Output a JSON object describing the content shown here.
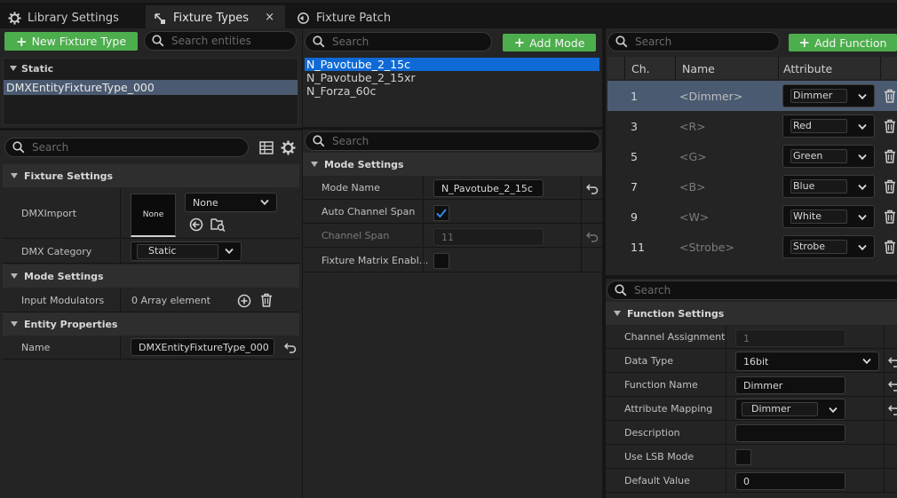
{
  "tabs": [
    {
      "label": "Library Settings",
      "icon": "gear-icon",
      "active": false
    },
    {
      "label": "Fixture Types",
      "icon": "fixture-type-icon",
      "active": true,
      "close": "×"
    },
    {
      "label": "Fixture Patch",
      "icon": "fixture-patch-icon",
      "active": false
    }
  ],
  "left": {
    "new_fixture_button": "New Fixture Type",
    "search_entities_placeholder": "Search entities",
    "group_label": "Static",
    "entities": [
      "DMXEntityFixtureType_000"
    ],
    "details_search_placeholder": "Search",
    "sections": {
      "fixture_settings": "Fixture Settings",
      "mode_settings": "Mode Settings",
      "entity_properties": "Entity Properties"
    },
    "dmx_import_label": "DMXImport",
    "dmx_import_thumb": "None",
    "dmx_import_value": "None",
    "dmx_category_label": "DMX Category",
    "dmx_category_value": "Static",
    "input_modulators_label": "Input Modulators",
    "input_modulators_value": "0 Array element",
    "name_label": "Name",
    "name_value": "DMXEntityFixtureType_000"
  },
  "middle": {
    "search_placeholder": "Search",
    "add_mode_button": "Add Mode",
    "modes": [
      "N_Pavotube_2_15c",
      "N_Pavotube_2_15xr",
      "N_Forza_60c"
    ],
    "selected_mode_index": 0,
    "details_search_placeholder": "Search",
    "mode_settings_header": "Mode Settings",
    "mode_name_label": "Mode Name",
    "mode_name_value": "N_Pavotube_2_15c",
    "auto_channel_span_label": "Auto Channel Span",
    "auto_channel_span_checked": true,
    "channel_span_label": "Channel Span",
    "channel_span_value": "11",
    "fixture_matrix_label": "Fixture Matrix Enabl...",
    "fixture_matrix_checked": false
  },
  "right": {
    "search_placeholder": "Search",
    "add_function_button": "Add Function",
    "columns": {
      "ch": "Ch.",
      "name": "Name",
      "attribute": "Attribute"
    },
    "functions": [
      {
        "ch": "1",
        "name": "<Dimmer>",
        "attribute": "Dimmer"
      },
      {
        "ch": "3",
        "name": "<R>",
        "attribute": "Red"
      },
      {
        "ch": "5",
        "name": "<G>",
        "attribute": "Green"
      },
      {
        "ch": "7",
        "name": "<B>",
        "attribute": "Blue"
      },
      {
        "ch": "9",
        "name": "<W>",
        "attribute": "White"
      },
      {
        "ch": "11",
        "name": "<Strobe>",
        "attribute": "Strobe"
      }
    ],
    "selected_function_index": 0,
    "details_search_placeholder": "Search",
    "function_settings_header": "Function Settings",
    "channel_assignment_label": "Channel Assignment",
    "channel_assignment_value": "1",
    "data_type_label": "Data Type",
    "data_type_value": "16bit",
    "function_name_label": "Function Name",
    "function_name_value": "Dimmer",
    "attribute_mapping_label": "Attribute Mapping",
    "attribute_mapping_value": "Dimmer",
    "description_label": "Description",
    "description_value": "",
    "use_lsb_label": "Use LSB Mode",
    "use_lsb_checked": false,
    "default_value_label": "Default Value",
    "default_value_value": "0"
  },
  "colors": {
    "accent_green": "#4cae4c",
    "selection_blue": "#0f6ad6",
    "selected_row": "#4a5a70",
    "panel_bg": "#242424"
  }
}
